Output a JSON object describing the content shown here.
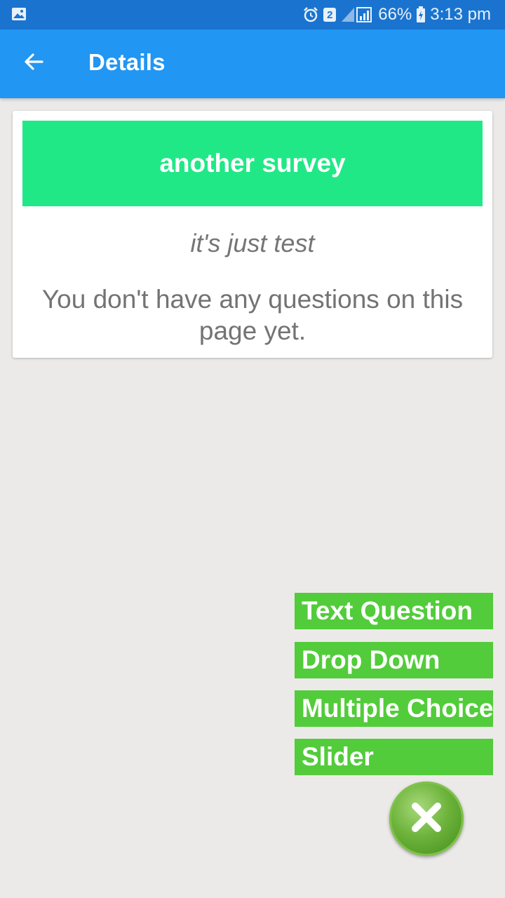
{
  "status_bar": {
    "sim_number": "2",
    "battery": "66%",
    "time": "3:13 pm",
    "icons": [
      "gallery-icon",
      "alarm-icon",
      "signal-icon",
      "battery-icon"
    ]
  },
  "app_bar": {
    "back_icon": "arrow-left-icon",
    "title": "Details"
  },
  "survey": {
    "title": "another survey",
    "description": "it's just test",
    "empty_message": "You don't have any questions on this page yet.",
    "banner_color": "#21e886"
  },
  "add_menu": {
    "items": [
      {
        "label": "Text Question"
      },
      {
        "label": "Drop Down"
      },
      {
        "label": "Multiple Choice"
      },
      {
        "label": "Slider"
      }
    ],
    "item_color": "#52cc3a",
    "close_icon": "close-icon"
  },
  "colors": {
    "status_bar": "#1a74cf",
    "app_bar": "#2196f3",
    "background": "#eceae8"
  }
}
